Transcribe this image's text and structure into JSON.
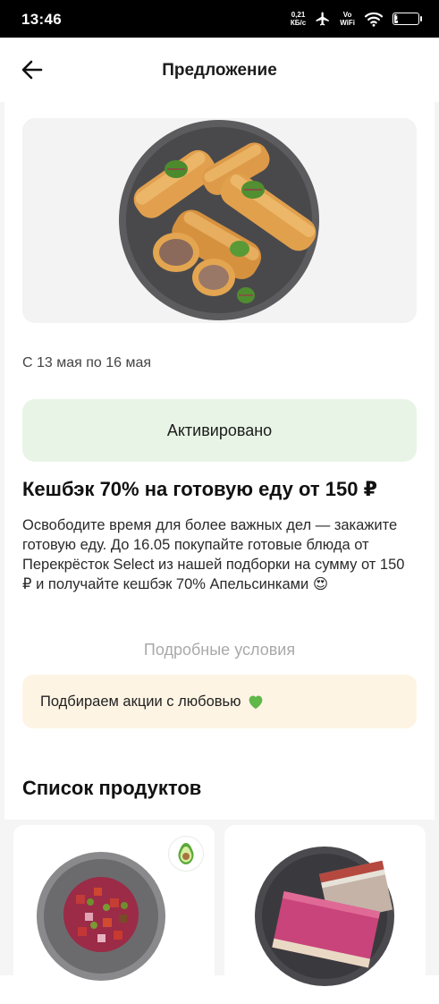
{
  "status_bar": {
    "time": "13:46",
    "net_speed_value": "0,21",
    "net_speed_unit": "КБ/с",
    "vo_label": "Vo",
    "wifi_label": "WiFi",
    "battery": "16",
    "battery_level": 0.16
  },
  "header": {
    "title": "Предложение",
    "back_icon": "arrow-left-icon"
  },
  "offer": {
    "image_alt": "pancake-rolls-plate",
    "date_range": "С 13 мая по 16 мая",
    "activated_label": "Активировано",
    "title": "Кешбэк 70% на готовую еду от 150 ₽",
    "description": "Освободите время для более важных дел — закажите готовую еду. До 16.05 покупайте готовые блюда от Перекрёсток Select из нашей подборки на сумму от 150 ₽ и получайте кешбэк 70% Апельсинками 😍",
    "terms_link": "Подробные условия",
    "love_text": "Подбираем акции с любовью",
    "love_icon": "green-heart-icon"
  },
  "products": {
    "title": "Список продуктов",
    "items": [
      {
        "image": "vinegret-salad-plate",
        "badge_icon": "avocado-icon"
      },
      {
        "image": "herring-under-fur-coat-plate"
      }
    ]
  },
  "colors": {
    "activated_bg": "#e8f5e6",
    "love_bg": "#fdf4e4",
    "terms_link": "#a9a9a9"
  }
}
